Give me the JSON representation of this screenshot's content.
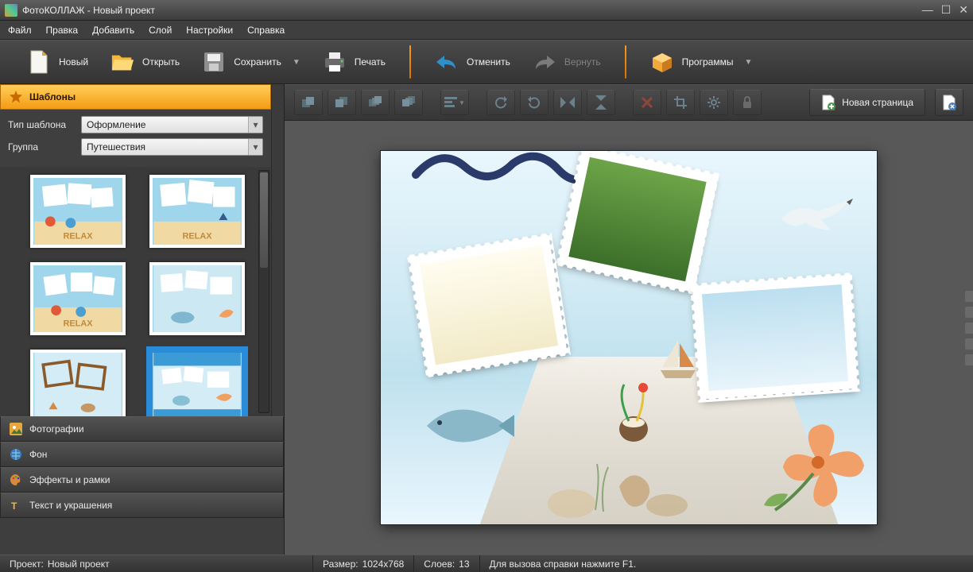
{
  "window": {
    "title": "ФотоКОЛЛАЖ - Новый проект"
  },
  "menu": {
    "items": [
      "Файл",
      "Правка",
      "Добавить",
      "Слой",
      "Настройки",
      "Справка"
    ]
  },
  "toolbar": {
    "new": "Новый",
    "open": "Открыть",
    "save": "Сохранить",
    "print": "Печать",
    "undo": "Отменить",
    "redo": "Вернуть",
    "programs": "Программы"
  },
  "sidebar": {
    "templates_header": "Шаблоны",
    "type_label": "Тип шаблона",
    "type_value": "Оформление",
    "group_label": "Группа",
    "group_value": "Путешествия",
    "sections": {
      "photos": "Фотографии",
      "background": "Фон",
      "effects": "Эффекты и рамки",
      "text": "Текст и украшения"
    }
  },
  "canvas_toolbar": {
    "new_page": "Новая страница"
  },
  "status": {
    "project_label": "Проект:",
    "project_value": "Новый проект",
    "size_label": "Размер:",
    "size_value": "1024x768",
    "layers_label": "Слоев:",
    "layers_value": "13",
    "help": "Для вызова справки нажмите F1."
  }
}
